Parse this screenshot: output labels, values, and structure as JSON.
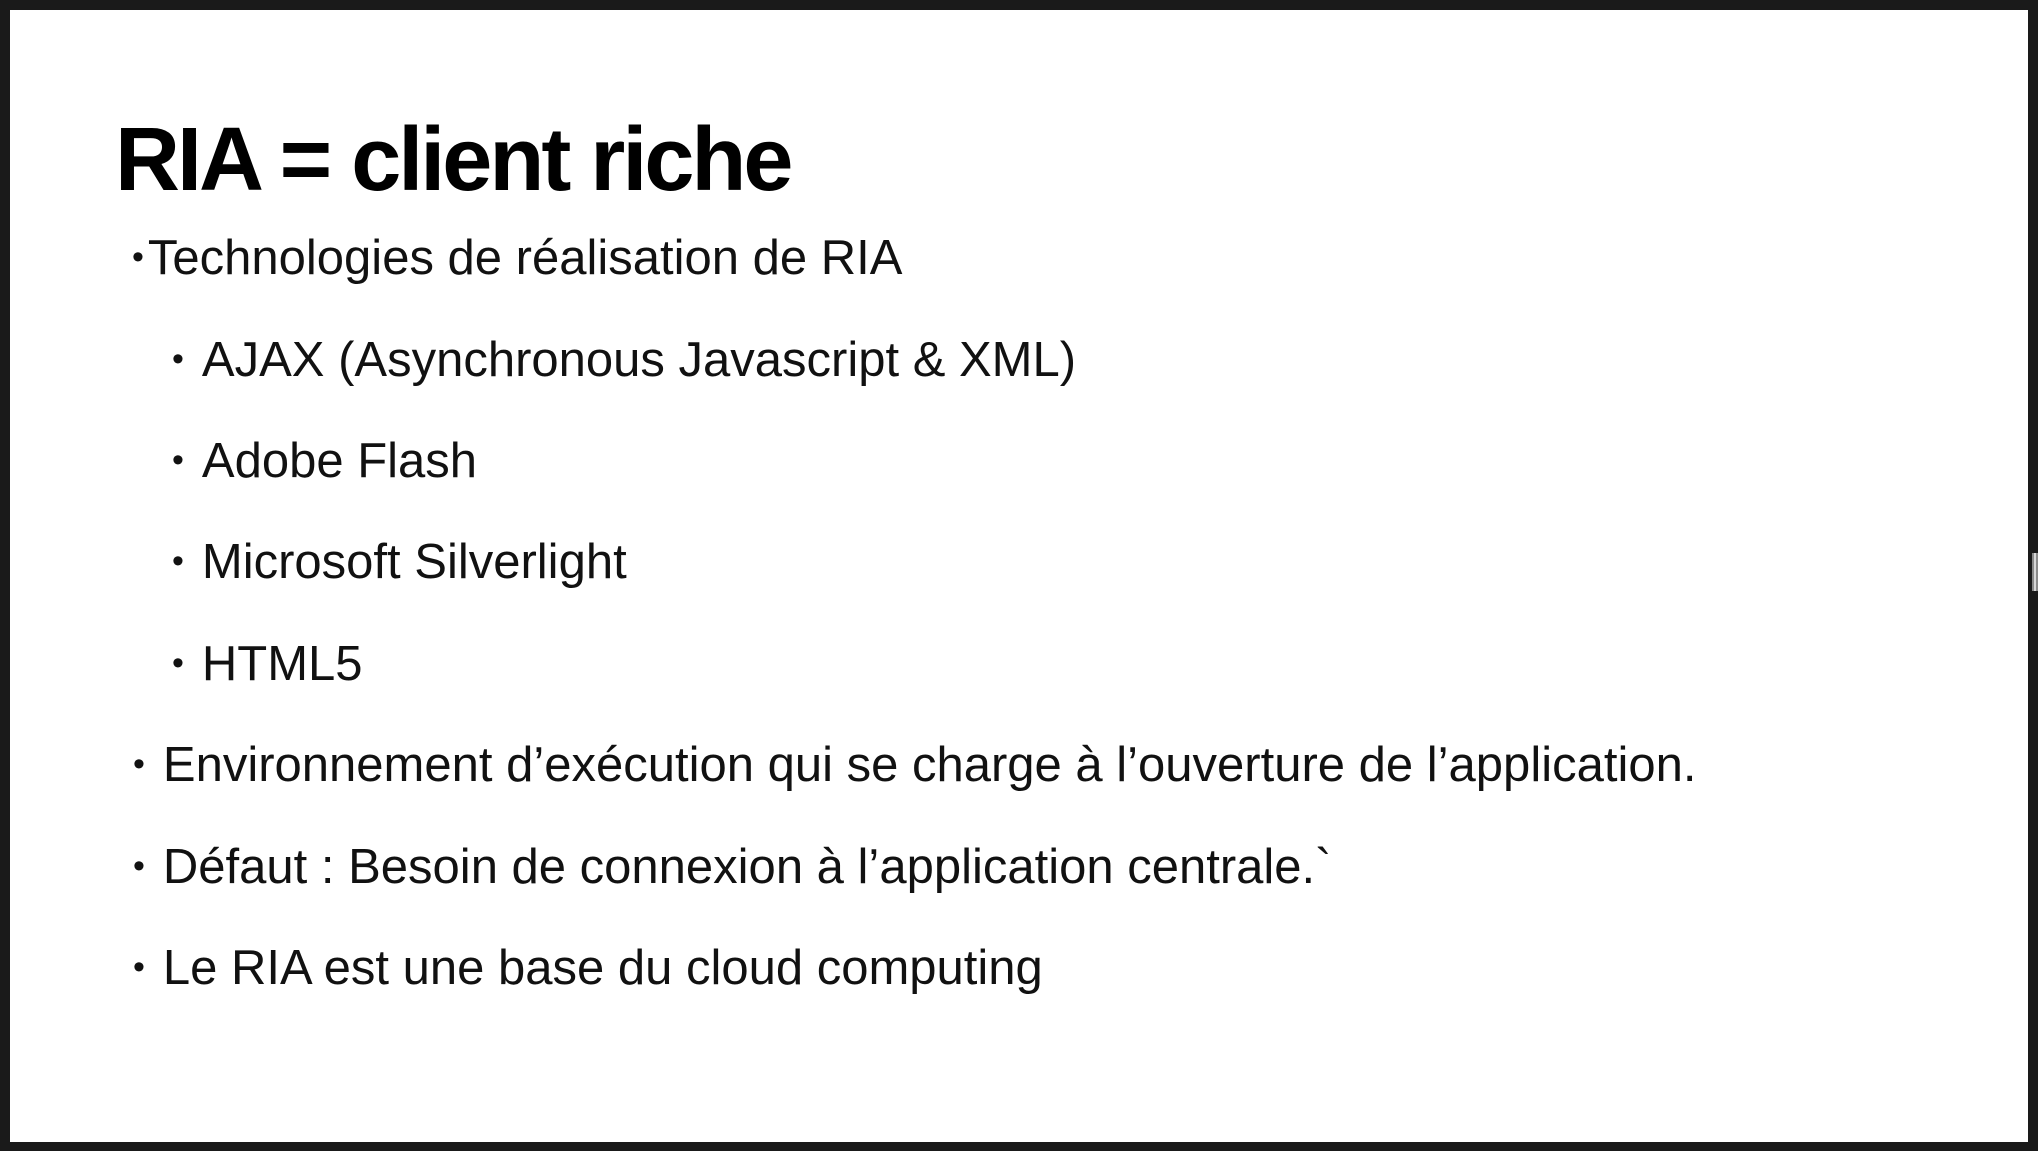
{
  "slide": {
    "title": "RIA = client riche",
    "bullet_glyph": "•",
    "items": [
      {
        "level": 1,
        "text": "Technologies de réalisation de RIA"
      },
      {
        "level": 2,
        "text": "AJAX (Asynchronous Javascript & XML)"
      },
      {
        "level": 2,
        "text": "Adobe Flash"
      },
      {
        "level": 2,
        "text": "Microsoft Silverlight"
      },
      {
        "level": 2,
        "text": "HTML5"
      },
      {
        "level": 1,
        "text": "Environnement d’exécution qui se charge à l’ouverture de l’application."
      },
      {
        "level": 1,
        "text": "Défaut : Besoin de connexion à l’application centrale.`"
      },
      {
        "level": 1,
        "text": "Le RIA est une base du cloud computing"
      }
    ]
  },
  "colors": {
    "background": "#ffffff",
    "frame": "#1a1a1a",
    "text": "#111111"
  }
}
